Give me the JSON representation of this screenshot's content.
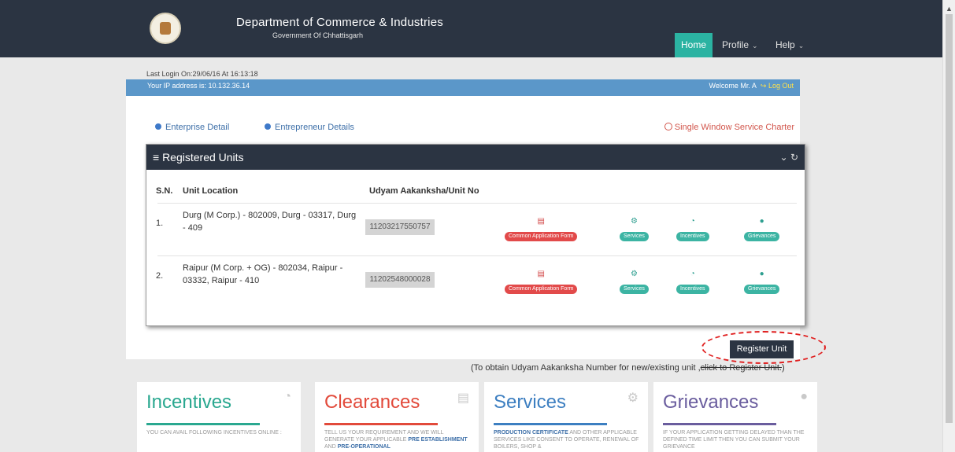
{
  "header": {
    "title": "Department of Commerce & Industries",
    "subtitle": "Government Of Chhattisgarh",
    "nav": {
      "home": "Home",
      "profile": "Profile",
      "help": "Help"
    }
  },
  "session": {
    "last_login": "Last Login On:29/06/16 At 16:13:18",
    "ip": "Your IP address is: 10.132.36.14",
    "welcome": "Welcome Mr. A",
    "logout": "Log Out"
  },
  "links": {
    "enterprise": "Enterprise Detail",
    "entrepreneur": "Entrepreneur Details",
    "charter": "Single Window Service Charter"
  },
  "units": {
    "title": "Registered Units",
    "headers": {
      "sn": "S.N.",
      "location": "Unit Location",
      "udyam": "Udyam Aakanksha/Unit No"
    },
    "rows": [
      {
        "sn": "1.",
        "location": "Durg (M Corp.) - 802009, Durg - 03317, Durg - 409",
        "udyam": "11203217550757"
      },
      {
        "sn": "2.",
        "location": "Raipur (M Corp. + OG) - 802034, Raipur - 03332, Raipur - 410",
        "udyam": "11202548000028"
      }
    ],
    "actions": {
      "caf": "Common Application Form",
      "services": "Services",
      "incentives": "Incentives",
      "grievances": "Grievances"
    }
  },
  "register": {
    "button": "Register Unit",
    "note_main": "(To obtain Udyam Aakanksha Number for new/existing unit ,",
    "note_click": "click to Register Unit.",
    "note_end": ")"
  },
  "cards": {
    "incentives": {
      "title": "Incentives",
      "text": "YOU CAN AVAIL FOLLOWING INCENTIVES ONLINE :",
      "color": "#2aa890"
    },
    "clearances": {
      "title": "Clearances",
      "text1": "TELL US YOUR REQUIREMENT AND WE WILL GENERATE YOUR APPLICABLE ",
      "bold1": "PRE ESTABLISHMENT",
      "text2": " AND ",
      "bold2": "PRE-OPERATIONAL",
      "color": "#e24a3b"
    },
    "services": {
      "title": "Services",
      "bold": "PRODUCTION CERTIFICATE",
      "text": " AND OTHER APPLICABLE SERVICES LIKE CONSENT TO OPERATE, RENEWAL OF BOILERS, SHOP &",
      "color": "#3d7fc1"
    },
    "grievances": {
      "title": "Grievances",
      "text": "IF YOUR APPLICATION GETTING DELAYED THAN THE DEFINED TIME LIMIT THEN YOU CAN SUBMIT YOUR GRIEVANCE",
      "color": "#6a5d9e"
    }
  }
}
